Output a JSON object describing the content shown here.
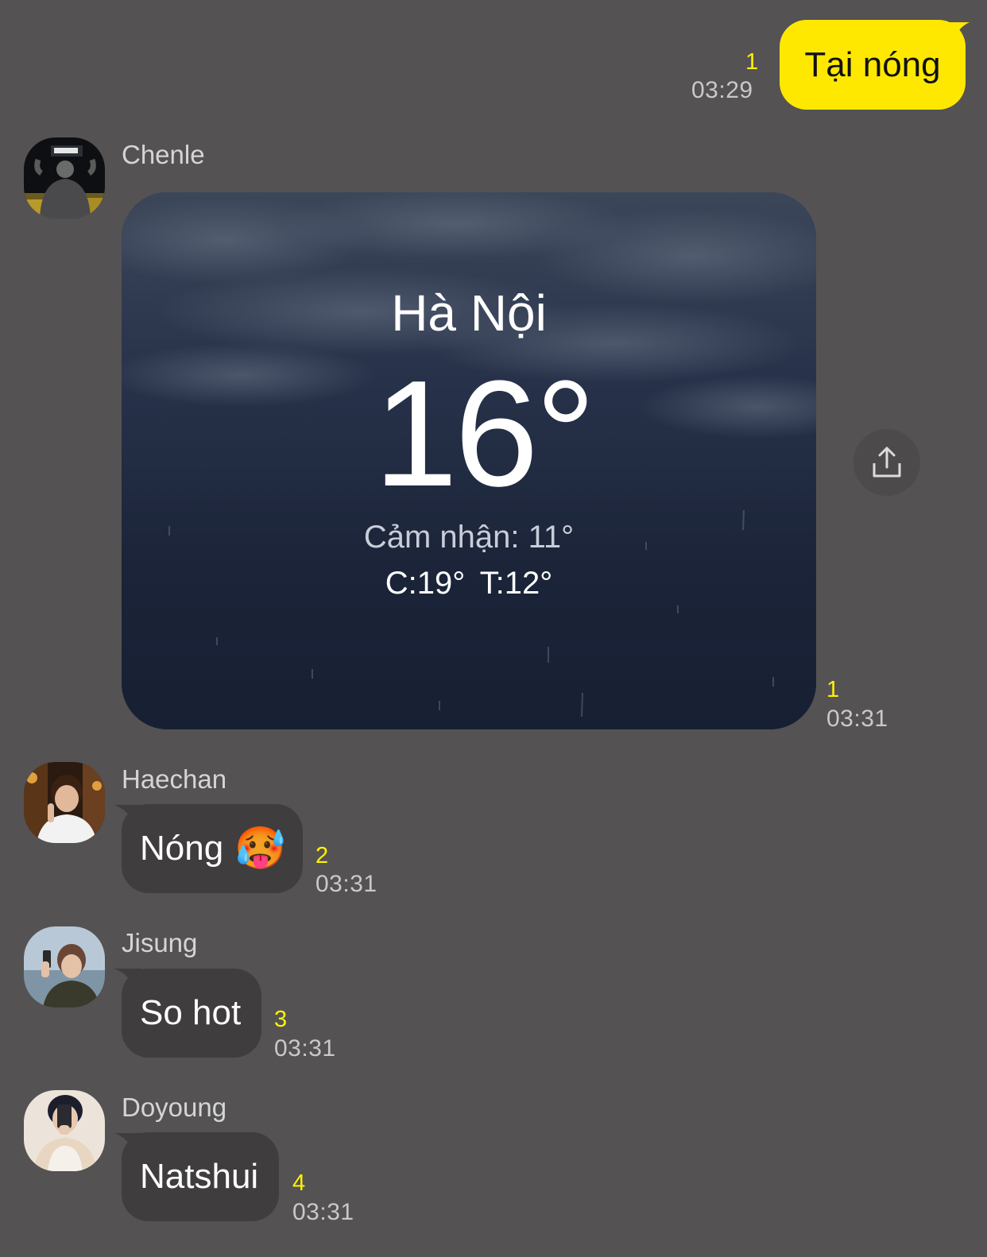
{
  "messages": {
    "outgoing": {
      "text": "Tại nóng",
      "unread": "1",
      "time": "03:29"
    },
    "chenle": {
      "sender": "Chenle",
      "unread": "1",
      "time": "03:31",
      "weather": {
        "city": "Hà Nội",
        "temperature": "16°",
        "feels_like": "Cảm nhận: 11°",
        "high_low": "C:19°  T:12°"
      }
    },
    "haechan": {
      "sender": "Haechan",
      "text": "Nóng",
      "emoji": "🥵",
      "unread": "2",
      "time": "03:31"
    },
    "jisung": {
      "sender": "Jisung",
      "text": "So hot",
      "unread": "3",
      "time": "03:31"
    },
    "doyoung": {
      "sender": "Doyoung",
      "text": "Natshui",
      "unread": "4",
      "time": "03:31"
    }
  },
  "icons": {
    "share": "share-icon"
  },
  "colors": {
    "background": "#545253",
    "outgoing_bubble": "#ffe800",
    "incoming_bubble": "#3f3d3e",
    "unread_count": "#fff200"
  }
}
